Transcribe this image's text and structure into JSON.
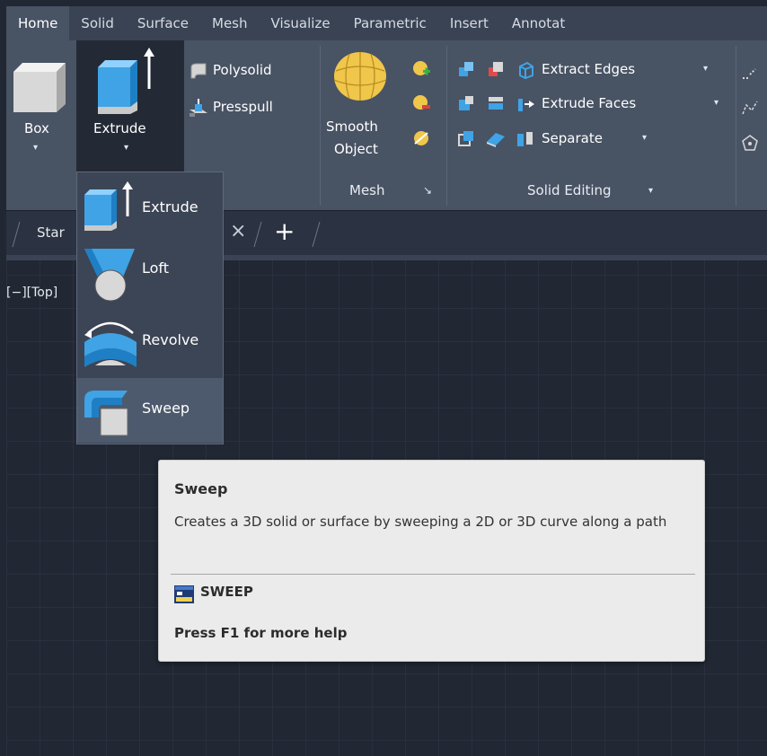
{
  "ribbon_tabs": [
    "Home",
    "Solid",
    "Surface",
    "Mesh",
    "Visualize",
    "Parametric",
    "Insert",
    "Annotat"
  ],
  "ribbon": {
    "box_label": "Box",
    "extrude_label": "Extrude",
    "polysolid_label": "Polysolid",
    "presspull_label": "Presspull",
    "smooth_object_line1": "Smooth",
    "smooth_object_line2": "Object",
    "mesh_panel_title": "Mesh",
    "panel_launcher_glyph": "↘",
    "extract_edges_label": "Extract Edges",
    "extrude_faces_label": "Extrude Faces",
    "separate_label": "Separate",
    "solid_editing_panel_title": "Solid Editing"
  },
  "doc_tabs": {
    "start_tab": "Star",
    "close_glyph": "×",
    "add_glyph": "+"
  },
  "viewport_label": "[−][Top]",
  "dropdown": {
    "items": [
      "Extrude",
      "Loft",
      "Revolve",
      "Sweep"
    ],
    "highlighted": "Sweep"
  },
  "tooltip": {
    "title": "Sweep",
    "description": "Creates a 3D solid or surface by sweeping a 2D or 3D curve along a path",
    "command": "SWEEP",
    "help": "Press F1 for more help"
  },
  "colors": {
    "tab_bar": "#3a4354",
    "ribbon": "#485364",
    "canvas": "#212733",
    "tooltip_bg": "#ebebeb",
    "icon_blue": "#3fa3e6"
  }
}
